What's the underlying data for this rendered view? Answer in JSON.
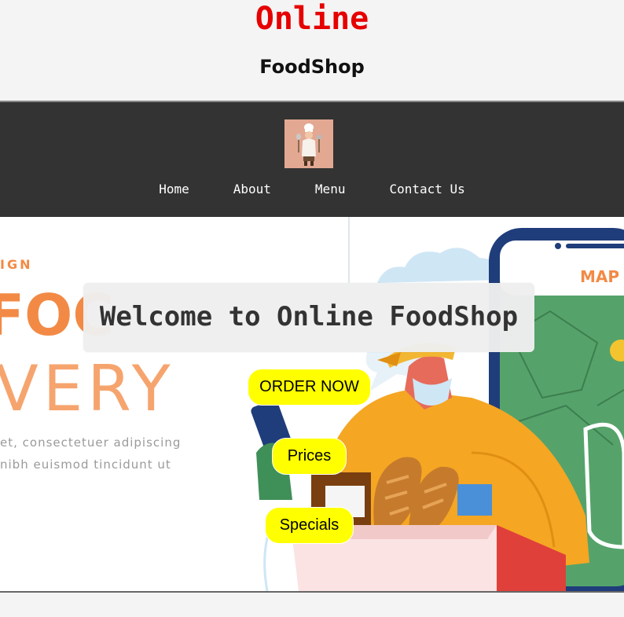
{
  "header": {
    "title": "Online",
    "subtitle": "FoodShop"
  },
  "navbar": {
    "logo_icon": "chef-logo-icon",
    "links": [
      {
        "label": "Home"
      },
      {
        "label": "About"
      },
      {
        "label": "Menu"
      },
      {
        "label": "Contact Us"
      }
    ]
  },
  "hero": {
    "welcome": "Welcome to Online FoodShop",
    "art_text": {
      "line_small": "IGN",
      "line_large_orange": "FOC",
      "line_very": "VERY",
      "para1": "et, consectetuer adipiscing",
      "para2": "nibh euismod tincidunt ut",
      "phone_label": "MAP"
    },
    "buttons": {
      "order": "ORDER NOW",
      "prices": "Prices",
      "specials": "Specials"
    }
  },
  "colors": {
    "brand_red": "#e60000",
    "nav_bg": "#333333",
    "button_yellow": "#ffff00",
    "orange_accent": "#f28a45"
  }
}
